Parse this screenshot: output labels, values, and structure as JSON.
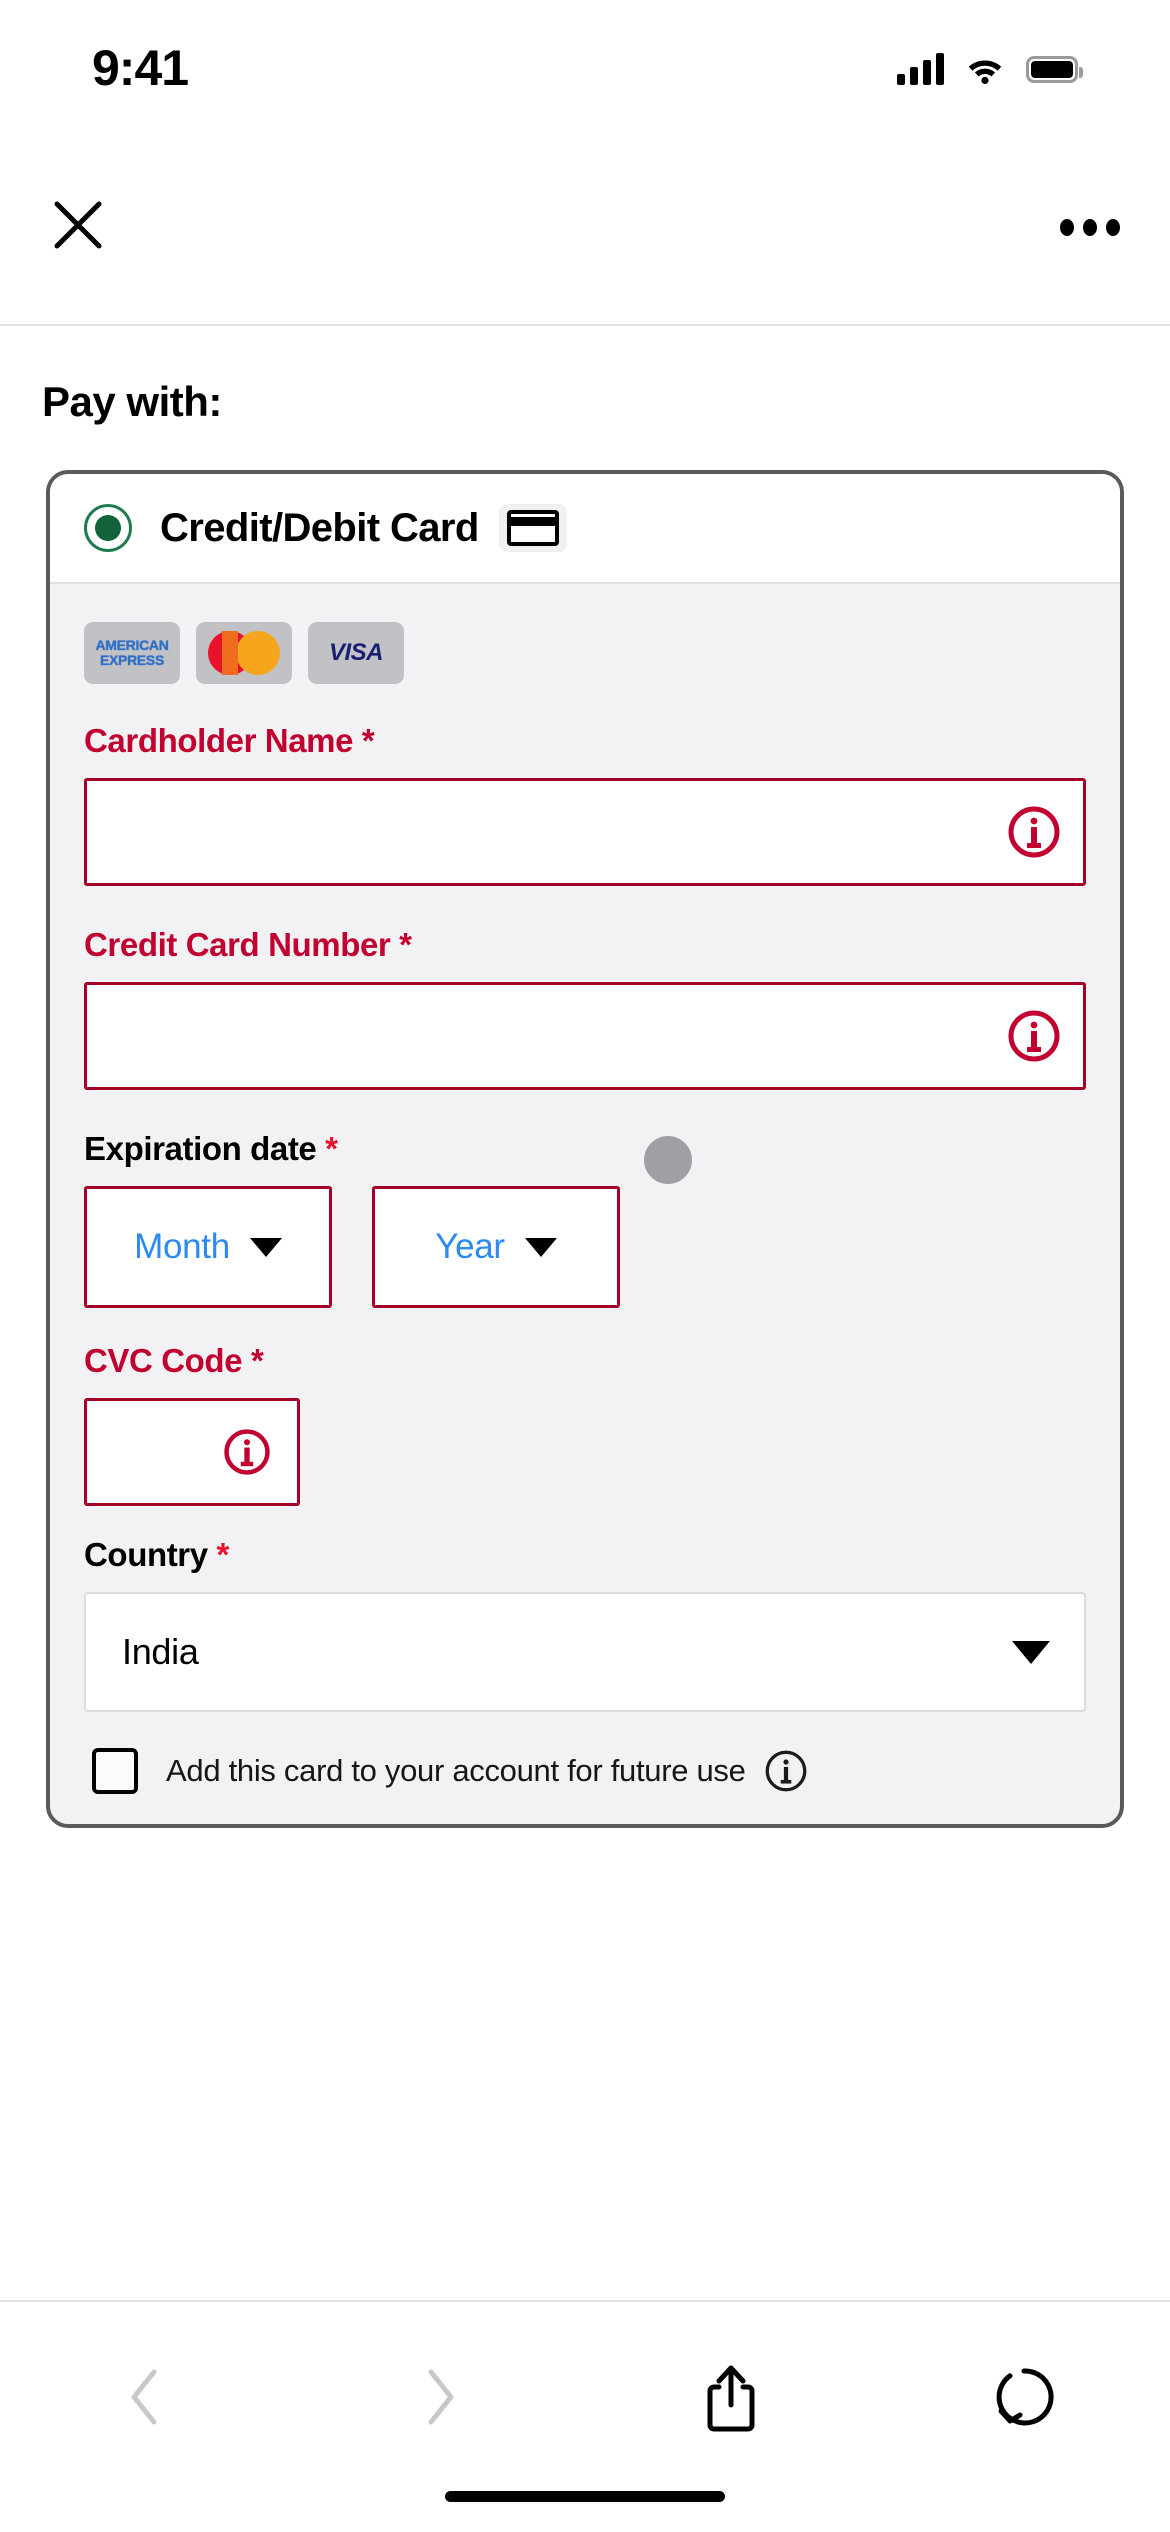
{
  "status_bar": {
    "time": "9:41",
    "cellular_icon": "cellular-bars-icon",
    "wifi_icon": "wifi-icon",
    "battery_icon": "battery-icon"
  },
  "nav_bar": {
    "close_icon": "close-icon",
    "menu_icon": "more-options-icon"
  },
  "page": {
    "heading": "Pay with:"
  },
  "payment_method": {
    "selected": true,
    "label": "Credit/Debit Card",
    "card_icon": "credit-card-icon",
    "radio_color": "#12633a",
    "accepted_brands": [
      {
        "name": "American Express",
        "line1": "AMERICAN",
        "line2": "EXPRESS",
        "text_color": "#2d6fc4"
      },
      {
        "name": "Mastercard",
        "color_left": "#e8122b",
        "color_right": "#f5a61d"
      },
      {
        "name": "Visa",
        "text": "VISA",
        "text_color": "#1a1f71"
      }
    ]
  },
  "form": {
    "error_color": "#c10230",
    "border_color": "#a50026",
    "link_color": "#2b8af0",
    "cardholder_name": {
      "label": "Cardholder Name",
      "required_mark": "*",
      "value": "",
      "placeholder": "",
      "info_icon": "info-icon",
      "state": "error"
    },
    "credit_card_number": {
      "label": "Credit Card Number",
      "required_mark": "*",
      "value": "",
      "placeholder": "",
      "info_icon": "info-icon",
      "state": "error"
    },
    "expiration_date": {
      "label": "Expiration date",
      "required_mark": "*",
      "month": {
        "value": "Month",
        "caret_icon": "chevron-down-icon"
      },
      "year": {
        "value": "Year",
        "caret_icon": "chevron-down-icon"
      },
      "state": "error"
    },
    "cvc_code": {
      "label": "CVC Code",
      "required_mark": "*",
      "value": "",
      "placeholder": "",
      "info_icon": "info-icon",
      "state": "error"
    },
    "country": {
      "label": "Country",
      "required_mark": "*",
      "value": "India",
      "caret_icon": "chevron-down-icon"
    },
    "save_card": {
      "checked": false,
      "label": "Add this card to your account for future use",
      "info_icon": "info-icon"
    }
  },
  "toolbar": {
    "back_icon": "chevron-left-icon",
    "forward_icon": "chevron-right-icon",
    "share_icon": "share-icon",
    "reload_icon": "reload-icon",
    "back_enabled": false,
    "forward_enabled": false
  }
}
